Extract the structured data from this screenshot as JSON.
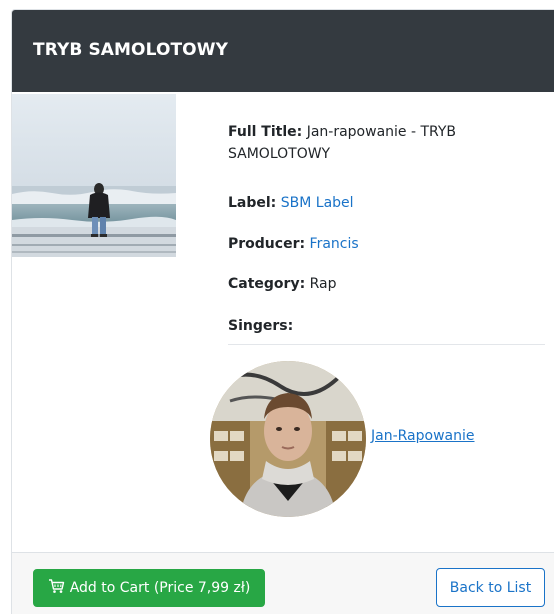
{
  "header": {
    "title": "TRYB SAMOLOTOWY"
  },
  "details": {
    "full_title_key": "Full Title:",
    "full_title_value": "Jan-rapowanie - TRYB SAMOLOTOWY",
    "label_key": "Label:",
    "label_value": "SBM Label",
    "producer_key": "Producer:",
    "producer_value": "Francis",
    "category_key": "Category:",
    "category_value": "Rap",
    "singers_key": "Singers:"
  },
  "singers": [
    {
      "name": "Jan-Rapowanie"
    }
  ],
  "footer": {
    "cart_icon": "cart-icon",
    "cart_label": "Add to Cart (Price 7,99 zł)",
    "back_label": "Back to List"
  },
  "colors": {
    "header_bg": "#343a40",
    "link": "#1a73c8",
    "success": "#28a745"
  }
}
